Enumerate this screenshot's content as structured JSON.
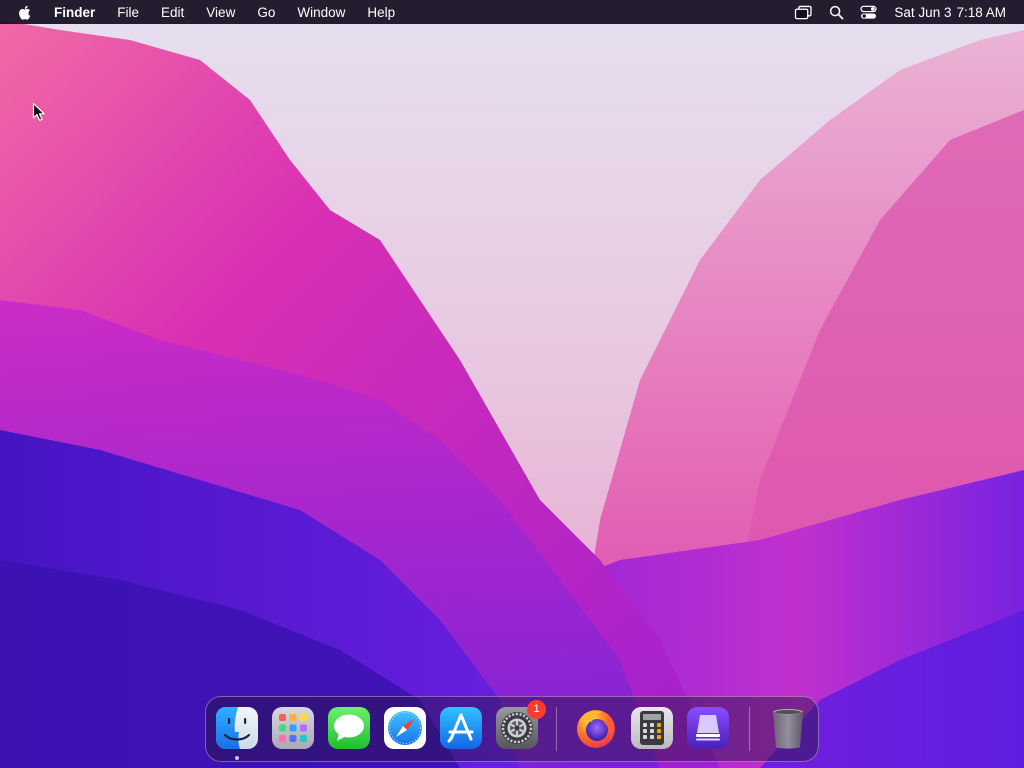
{
  "menubar": {
    "app_name": "Finder",
    "menus": [
      "File",
      "Edit",
      "View",
      "Go",
      "Window",
      "Help"
    ],
    "status_icons": [
      "screen-mirroring-icon",
      "spotlight-search-icon",
      "control-center-icon"
    ],
    "clock": {
      "date": "Sat Jun 3",
      "time": "7:18 AM"
    }
  },
  "dock": {
    "apps": [
      {
        "name": "Finder",
        "icon": "finder-icon",
        "running": true
      },
      {
        "name": "Launchpad",
        "icon": "launchpad-icon"
      },
      {
        "name": "Messages",
        "icon": "messages-icon"
      },
      {
        "name": "Safari",
        "icon": "safari-icon"
      },
      {
        "name": "App Store",
        "icon": "app-store-icon"
      },
      {
        "name": "System Settings",
        "icon": "system-settings-icon",
        "badge": "1"
      }
    ],
    "other_apps": [
      {
        "name": "Firefox",
        "icon": "firefox-icon"
      },
      {
        "name": "Calculator",
        "icon": "calculator-icon"
      },
      {
        "name": "Apple Configurator",
        "icon": "apple-configurator-icon"
      }
    ],
    "trash": {
      "name": "Trash",
      "icon": "trash-icon"
    }
  },
  "colors": {
    "menubar_bg": "#140c1e",
    "badge": "#ff3b30",
    "wallpaper_pink": "#e0379f",
    "wallpaper_purple": "#5a1fd6",
    "wallpaper_light": "#e4dcf0"
  }
}
